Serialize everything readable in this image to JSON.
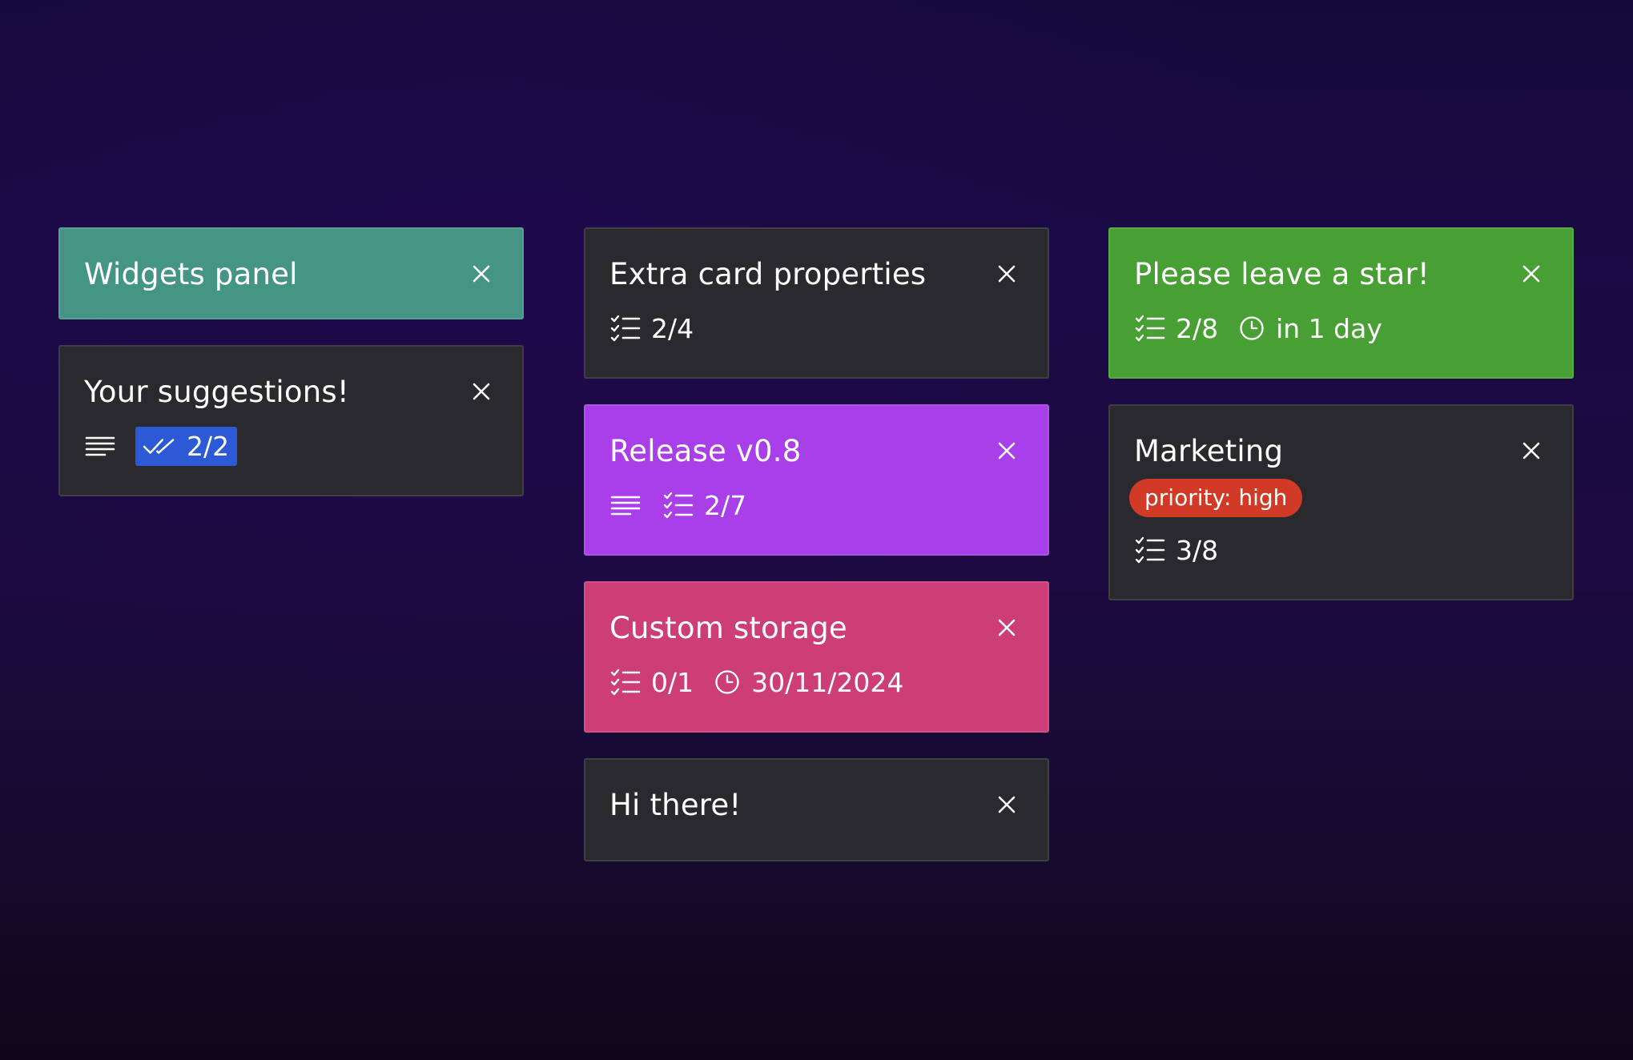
{
  "colors": {
    "teal": "#459585",
    "dark": "#2a2a2e",
    "purple": "#a83fe8",
    "pink": "#cd3e76",
    "green": "#48a035",
    "badge_blue": "#2c59d6",
    "tag_red": "#d13a26"
  },
  "icons": {
    "close": "close-icon",
    "checklist": "checklist-icon",
    "description": "description-icon",
    "checks_complete": "double-check-icon",
    "due": "clock-icon"
  },
  "columns": [
    {
      "cards": [
        {
          "title": "Widgets panel",
          "color": "#459585"
        },
        {
          "title": "Your suggestions!",
          "color": "#2a2a2e",
          "checks": "2/2"
        }
      ]
    },
    {
      "cards": [
        {
          "title": "Extra card properties",
          "color": "#2a2a2e",
          "checklist": "2/4"
        },
        {
          "title": "Release v0.8",
          "color": "#a83fe8",
          "checklist": "2/7"
        },
        {
          "title": "Custom storage",
          "color": "#cd3e76",
          "checklist": "0/1",
          "due": "30/11/2024"
        },
        {
          "title": "Hi there!",
          "color": "#2a2a2e"
        }
      ]
    },
    {
      "cards": [
        {
          "title": "Please leave a star!",
          "color": "#48a035",
          "checklist": "2/8",
          "due": "in 1 day"
        },
        {
          "title": "Marketing",
          "color": "#2a2a2e",
          "tag": "priority: high",
          "checklist": "3/8"
        }
      ]
    }
  ]
}
